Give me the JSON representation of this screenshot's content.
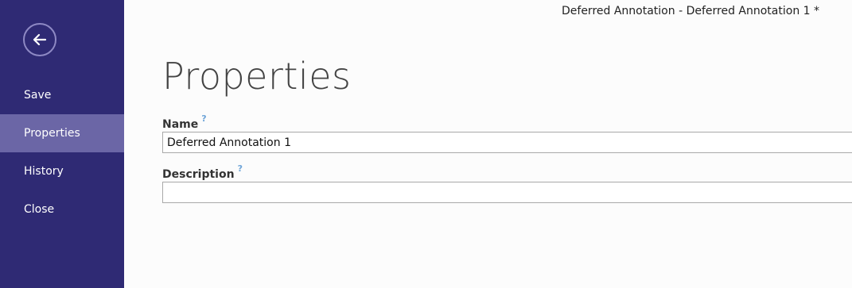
{
  "window": {
    "title": "Deferred Annotation - Deferred Annotation 1 *"
  },
  "sidebar": {
    "back_icon": "arrow-left-circle-icon",
    "items": [
      {
        "label": "Save",
        "selected": false
      },
      {
        "label": "Properties",
        "selected": true
      },
      {
        "label": "History",
        "selected": false
      },
      {
        "label": "Close",
        "selected": false
      }
    ]
  },
  "main": {
    "title": "Properties",
    "fields": [
      {
        "label": "Name",
        "help": "?",
        "value": "Deferred Annotation 1"
      },
      {
        "label": "Description",
        "help": "?",
        "value": ""
      }
    ]
  },
  "colors": {
    "sidebar_bg": "#2f2a74",
    "sidebar_selected_bg": "#6b66a6",
    "help_mark": "#6fa5d8"
  }
}
